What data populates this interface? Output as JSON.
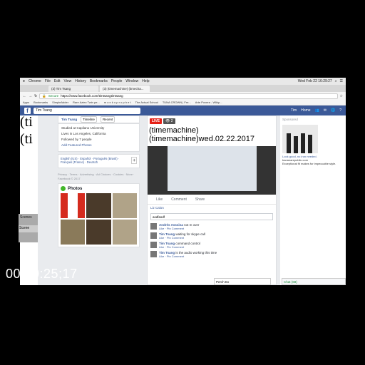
{
  "mac": {
    "apple": "",
    "menus": [
      "Chrome",
      "File",
      "Edit",
      "View",
      "History",
      "Bookmarks",
      "People",
      "Window",
      "Help"
    ],
    "clock": "Wed Feb 22  16:29:27",
    "user": "Tim"
  },
  "tabs": [
    {
      "label": "(3) Tim Tsang"
    },
    {
      "label": "(3) (timemachine) (timecha..."
    }
  ],
  "addr": {
    "secure": "Secure",
    "url": "https://www.facebook.com/timtsangtimtsang"
  },
  "bookmarks": [
    "Apps",
    "Bookmarks",
    "SimpleAdder",
    "Rare Aztec Twin pe...",
    "m o n k o p r o p h e t",
    "The Actual School",
    "TUNA CROWN | Fre...",
    "Arte Povera - Wikip..."
  ],
  "fb": {
    "search_value": "Tim Tsang",
    "user": "Tim",
    "home": "Home"
  },
  "bigtext": {
    "line1": "(ti",
    "line2": "(ti"
  },
  "profile": {
    "name": "Tim Tsang",
    "nav": [
      "Timeline",
      "Recent"
    ],
    "intro": [
      "Studied at Capilano University",
      "Lives in Los Angeles, California",
      "Followed by 7 people",
      "Add Featured Photos"
    ],
    "languages": "English (US) · Español · Português (Brasil) · Français (France) · Deutsch",
    "footer": "Privacy · Terms · Advertising · Ad Choices · Cookies · More · Facebook © 2017",
    "photos_title": "Photos"
  },
  "post": {
    "live": "LIVE",
    "title1": "(timemachine)",
    "title2": "(timemachine)wed.02.22.2017",
    "actions": [
      "Like",
      "Comment",
      "Share"
    ],
    "likes": "Liz Calon",
    "comment_input": "asdfasdf",
    "comments": [
      {
        "name": "Andrés Asssina",
        "text": "not m over",
        "meta": "Like · Pin Comment"
      },
      {
        "name": "Tim Tsang",
        "text": "waiting for skype call",
        "meta": "Like · Pin Comment"
      },
      {
        "name": "Tim Tsang",
        "text": "command control",
        "meta": "Like · Pin Comment"
      },
      {
        "name": "Tim Tsang",
        "text": "is the audio working this time",
        "meta": "Like · Pin Comment"
      }
    ]
  },
  "sidebar": {
    "sponsored": "Sponsored",
    "ad_title": "Look good, no iron needed.",
    "ad_site": "bananarepublic.com",
    "ad_text": "Exceptional fit makes for impeccable style."
  },
  "chat": {
    "label": "Chat (68)",
    "perch": "Perch Ex"
  },
  "bg": {
    "scenes": "Scenes",
    "scene": "Scene"
  },
  "timecode": "00:00:25;17"
}
